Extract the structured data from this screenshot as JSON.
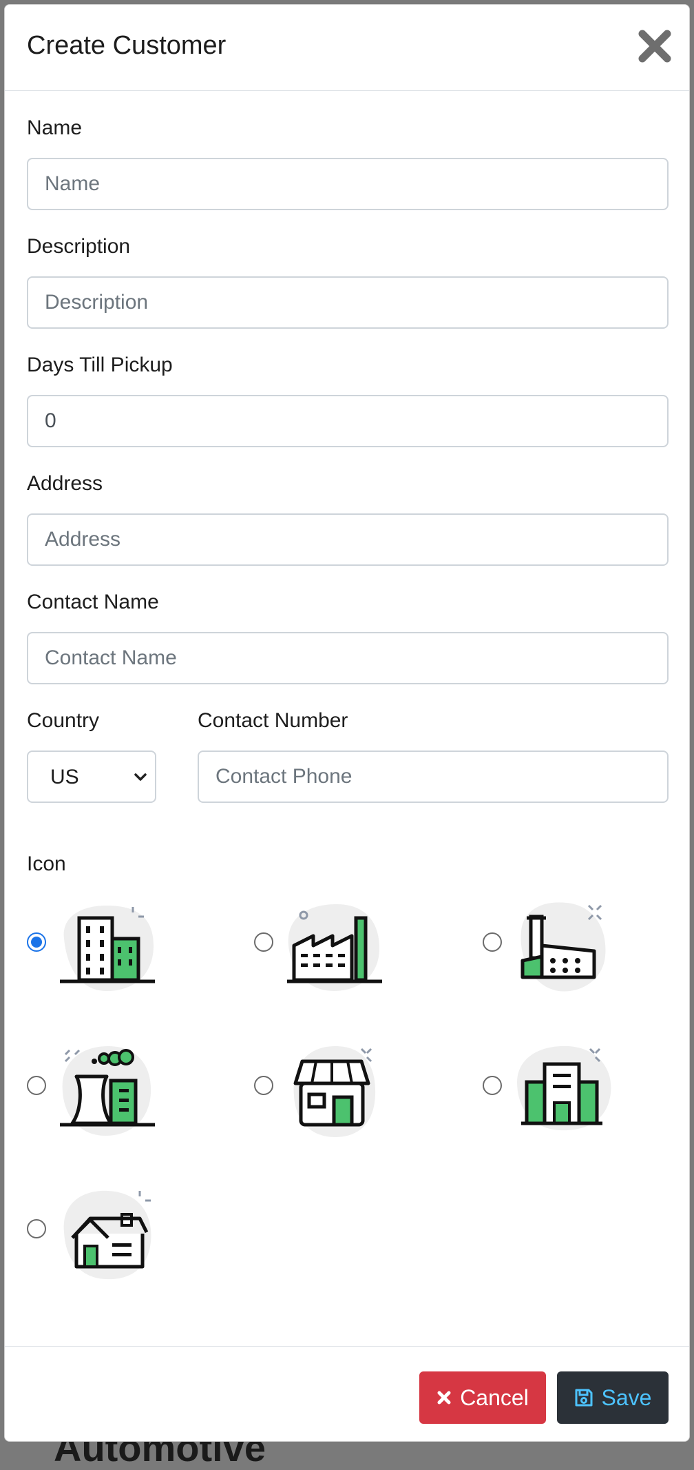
{
  "backdrop": {
    "partial_text": "Automotive"
  },
  "modal": {
    "title": "Create Customer",
    "close_icon": "close-icon"
  },
  "form": {
    "name": {
      "label": "Name",
      "placeholder": "Name",
      "value": ""
    },
    "description": {
      "label": "Description",
      "placeholder": "Description",
      "value": ""
    },
    "days_till_pickup": {
      "label": "Days Till Pickup",
      "placeholder": "0",
      "value": "0"
    },
    "address": {
      "label": "Address",
      "placeholder": "Address",
      "value": ""
    },
    "contact_name": {
      "label": "Contact Name",
      "placeholder": "Contact Name",
      "value": ""
    },
    "country": {
      "label": "Country",
      "value": "US"
    },
    "contact_number": {
      "label": "Contact Number",
      "placeholder": "Contact Phone",
      "value": ""
    },
    "icon": {
      "label": "Icon",
      "selected_index": 0,
      "options": [
        {
          "name": "office-building-icon"
        },
        {
          "name": "factory-chimney-icon"
        },
        {
          "name": "industrial-plant-icon"
        },
        {
          "name": "power-plant-icon"
        },
        {
          "name": "storefront-icon"
        },
        {
          "name": "warehouse-building-icon"
        },
        {
          "name": "house-icon"
        }
      ]
    }
  },
  "footer": {
    "cancel_label": "Cancel",
    "save_label": "Save"
  },
  "colors": {
    "accent_green": "#4cc26e",
    "radio_blue": "#1a73e8",
    "cancel_red": "#d63743",
    "save_dark": "#2b3138",
    "save_text": "#4dc3ff"
  }
}
